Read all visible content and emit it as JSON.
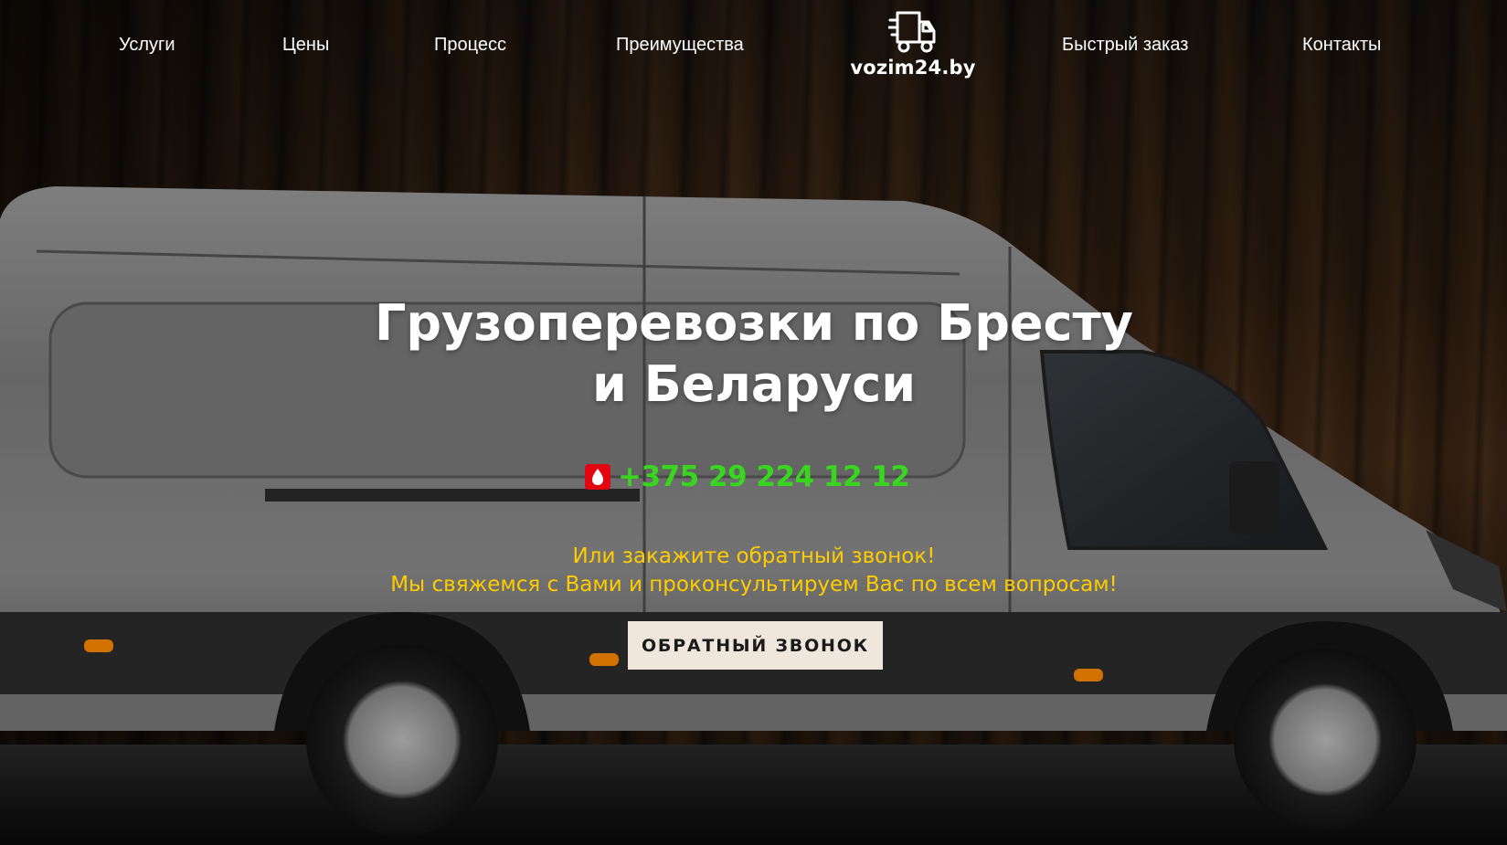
{
  "nav": {
    "items": [
      {
        "label": "Услуги"
      },
      {
        "label": "Цены"
      },
      {
        "label": "Процесс"
      },
      {
        "label": "Преимущества"
      },
      {
        "label": "Быстрый заказ"
      },
      {
        "label": "Контакты"
      }
    ]
  },
  "logo": {
    "text": "vozim24.by",
    "icon": "delivery-truck-icon"
  },
  "hero": {
    "title_line1": "Грузоперевозки по Бресту",
    "title_line2": "и Беларуси",
    "phone": {
      "operator_icon": "mts-icon",
      "number": "+375 29 224 12 12",
      "color": "#39d620"
    },
    "sub_line1": "Или закажите обратный звонок!",
    "sub_line2": "Мы свяжемся с Вами и проконсультируем Вас по всем вопросам!",
    "sub_color": "#ffcc00",
    "cta_label": "ОБРАТНЫЙ ЗВОНОК"
  }
}
